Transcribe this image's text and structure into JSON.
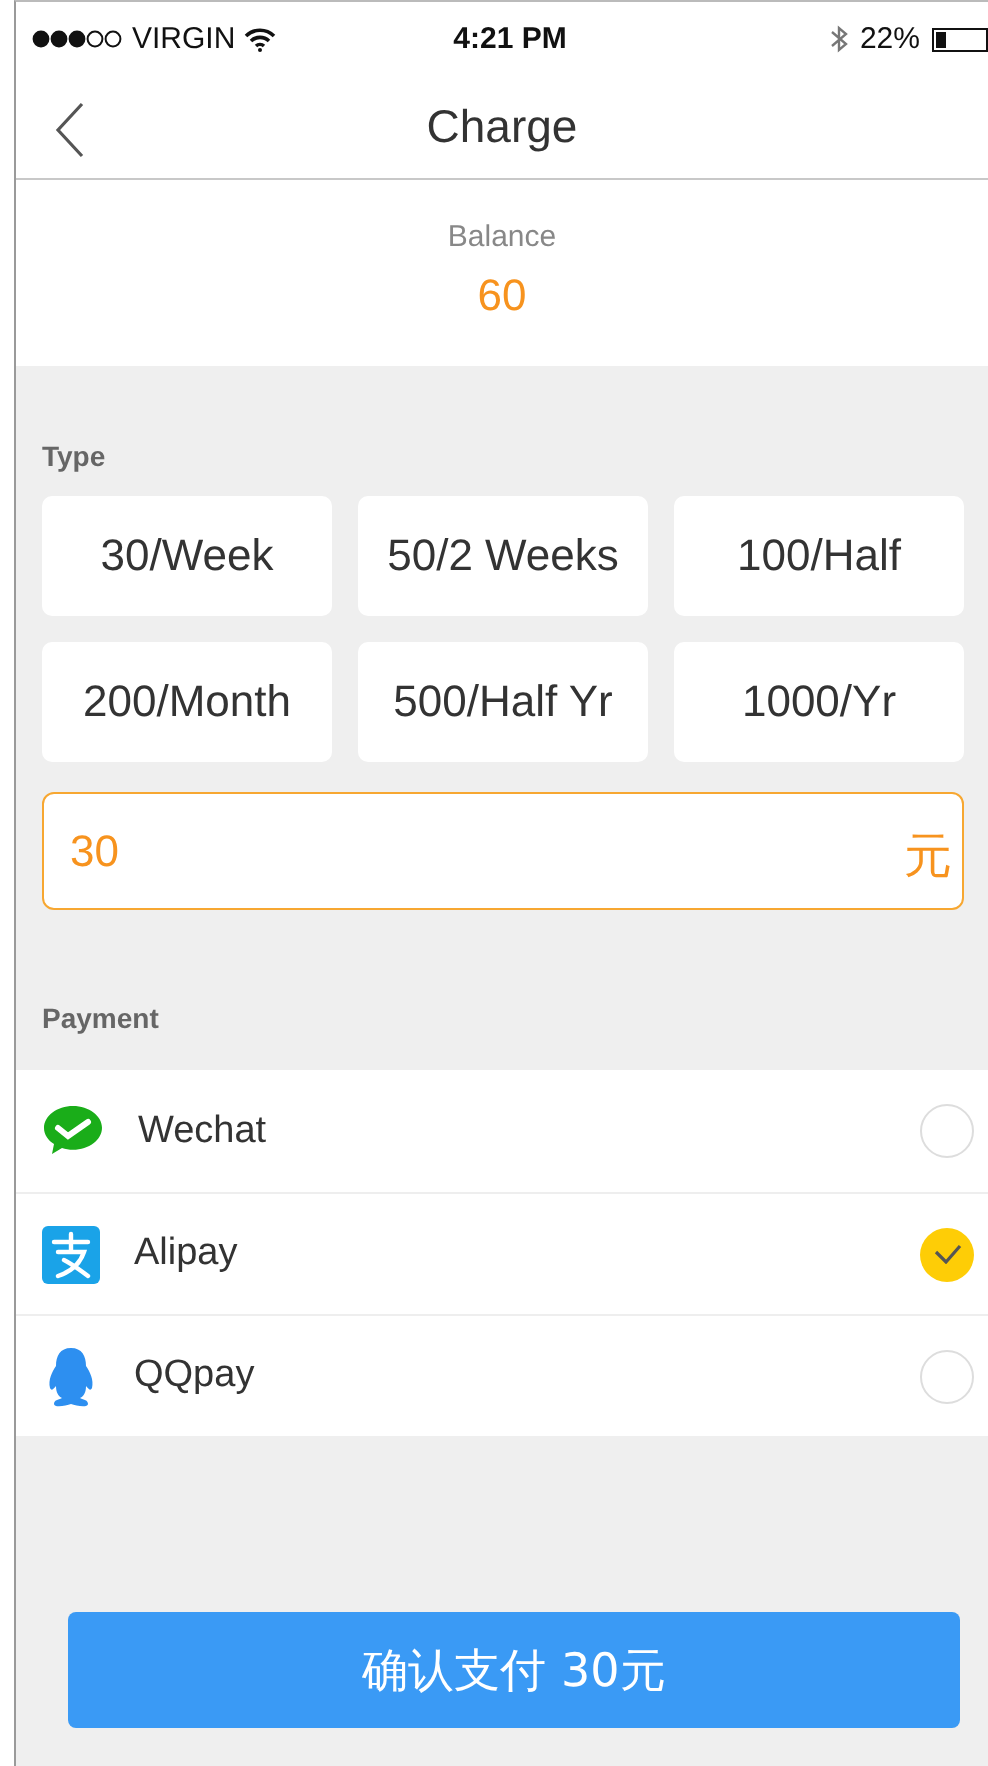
{
  "status_bar": {
    "carrier": "VIRGIN",
    "time": "4:21 PM",
    "battery": "22%"
  },
  "nav": {
    "title": "Charge"
  },
  "balance": {
    "label": "Balance",
    "value": "60"
  },
  "type": {
    "label": "Type",
    "options": [
      {
        "label": "30/Week",
        "selected": false
      },
      {
        "label": "50/2 Weeks",
        "selected": false
      },
      {
        "label": "100/Half",
        "selected": false
      },
      {
        "label": "200/Month",
        "selected": false
      },
      {
        "label": "500/Half Yr",
        "selected": false
      },
      {
        "label": "1000/Yr",
        "selected": false
      }
    ],
    "amount": {
      "value": "30",
      "unit": "元"
    }
  },
  "payment": {
    "label": "Payment",
    "methods": [
      {
        "kind": "wechat",
        "name": "Wechat",
        "selected": false
      },
      {
        "kind": "alipay",
        "name": "Alipay",
        "selected": true
      },
      {
        "kind": "qq",
        "name": "QQpay",
        "selected": false
      }
    ]
  },
  "confirm_button": "确认支付 30元"
}
